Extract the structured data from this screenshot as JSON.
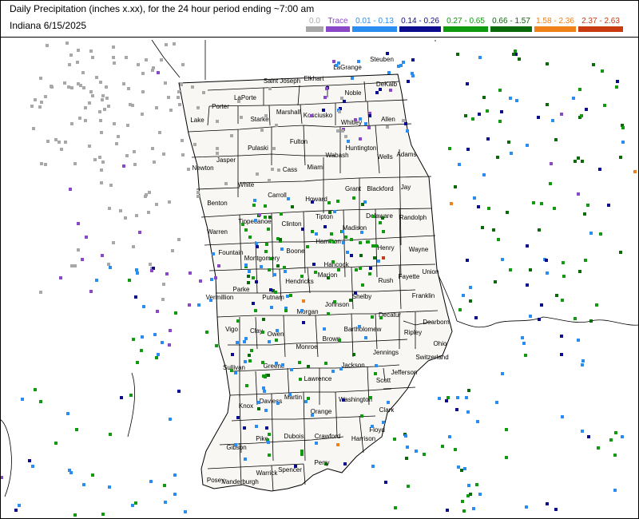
{
  "header": {
    "title": "Daily Precipitation (inches  x.xx),  for the 24 hour period ending ~7:00 am",
    "subtitle": "Indiana 6/15/2025"
  },
  "legend": [
    {
      "label": "0.0",
      "color": "#a8a8a8"
    },
    {
      "label": "Trace",
      "color": "#8a48c8"
    },
    {
      "label": "0.01 - 0.13",
      "color": "#2a8ef0"
    },
    {
      "label": "0.14 - 0.26",
      "color": "#0c0c8e"
    },
    {
      "label": "0.27 - 0.65",
      "color": "#0f9a0f"
    },
    {
      "label": "0.66 - 1.57",
      "color": "#0a6a0a"
    },
    {
      "label": "1.58 - 2.36",
      "color": "#f08018"
    },
    {
      "label": "2.37 - 2.63",
      "color": "#c83a10"
    }
  ],
  "counties": [
    "Steuben",
    "LaGrange",
    "Elkhart",
    "Saint Joseph",
    "LaPorte",
    "Porter",
    "Lake",
    "DeKalb",
    "Noble",
    "Kosciusko",
    "Marshall",
    "Starke",
    "Allen",
    "Whitley",
    "Fulton",
    "Pulaski",
    "Jasper",
    "Newton",
    "Huntington",
    "Wabash",
    "Miami",
    "Cass",
    "White",
    "Wells",
    "Adams",
    "Grant",
    "Blackford",
    "Jay",
    "Howard",
    "Carroll",
    "Benton",
    "Tipton",
    "Clinton",
    "Delaware",
    "Randolph",
    "Madison",
    "Tippecanoe",
    "Warren",
    "Fountain",
    "Hamilton",
    "Henry",
    "Wayne",
    "Boone",
    "Montgomery",
    "Hancock",
    "Union",
    "Fayette",
    "Hendricks",
    "Marion",
    "Rush",
    "Parke",
    "Vermillion",
    "Putnam",
    "Shelby",
    "Johnson",
    "Morgan",
    "Decatur",
    "Franklin",
    "Dearborn",
    "Ripley",
    "Vigo",
    "Clay",
    "Owen",
    "Monroe",
    "Brown",
    "Bartholomew",
    "Ohio",
    "Switzerland",
    "Jennings",
    "Jackson",
    "Greene",
    "Sullivan",
    "Lawrence",
    "Jefferson",
    "Scott",
    "Knox",
    "Daviess",
    "Martin",
    "Washington",
    "Orange",
    "Clark",
    "Floyd",
    "Harrison",
    "Crawford",
    "Dubois",
    "Pike",
    "Gibson",
    "Posey",
    "Vanderburgh",
    "Warrick",
    "Spencer",
    "Perry"
  ],
  "colors": {
    "map_fill": "#f8f7f4",
    "county_line": "#000000",
    "state_line": "#000000"
  }
}
